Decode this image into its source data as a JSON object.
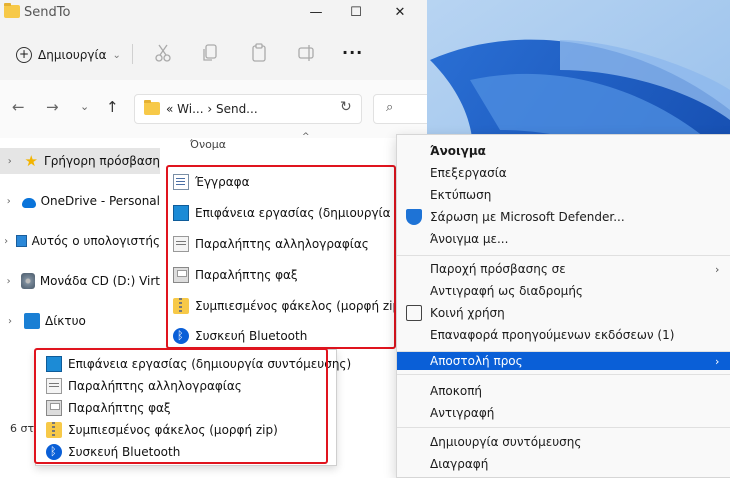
{
  "window": {
    "title": "SendTo",
    "minimize": "—",
    "maximize": "☐",
    "close": "✕"
  },
  "toolbar": {
    "new_label": "Δημιουργία",
    "new_caret": "⌄",
    "more": "···"
  },
  "address": {
    "path": "« Wi... › Send...",
    "chevron": "›",
    "refresh": "↻",
    "search_glyph": "⌕"
  },
  "nav": {
    "back": "←",
    "forward": "→",
    "dropdown": "⌄",
    "up": "↑"
  },
  "column_header": "Όνομα",
  "sort_caret": "^",
  "navpane": [
    {
      "label": "Γρήγορη πρόσβαση",
      "icon": "star-icon",
      "selected": true
    },
    {
      "label": "OneDrive - Personal",
      "icon": "cloud-icon",
      "selected": false
    },
    {
      "label": "Αυτός ο υπολογιστής",
      "icon": "computer-icon",
      "selected": false
    },
    {
      "label": "Μονάδα CD (D:) Virt",
      "icon": "cd-drive-icon",
      "selected": false
    },
    {
      "label": "Δίκτυο",
      "icon": "network-icon",
      "selected": false
    }
  ],
  "status": "6 στ",
  "files": [
    {
      "label": "Έγγραφα",
      "icon": "documents-icon"
    },
    {
      "label": "Επιφάνεια εργασίας (δημιουργία συντ",
      "icon": "desktop-icon"
    },
    {
      "label": "Παραλήπτης αλληλογραφίας",
      "icon": "mail-recipient-icon"
    },
    {
      "label": "Παραλήπτης φαξ",
      "icon": "fax-recipient-icon"
    },
    {
      "label": "Συμπιεσμένος φάκελος (μορφή zip)",
      "icon": "zip-folder-icon"
    },
    {
      "label": "Συσκευή Bluetooth",
      "icon": "bluetooth-icon"
    }
  ],
  "context_menu": [
    {
      "label": "Άνοιγμα",
      "bold": true
    },
    {
      "label": "Επεξεργασία"
    },
    {
      "label": "Εκτύπωση"
    },
    {
      "label": "Σάρωση με Microsoft Defender...",
      "icon": "defender-shield-icon"
    },
    {
      "label": "Άνοιγμα με..."
    },
    {
      "separator": true
    },
    {
      "label": "Παροχή πρόσβασης σε",
      "submenu": true
    },
    {
      "label": "Αντιγραφή ως διαδρομής"
    },
    {
      "label": "Κοινή χρήση",
      "icon": "share-icon"
    },
    {
      "label": "Επαναφορά προηγούμενων εκδόσεων (1)"
    },
    {
      "separator": true
    },
    {
      "label": "Αποστολή προς",
      "submenu": true,
      "highlighted": true
    },
    {
      "separator": true
    },
    {
      "label": "Αποκοπή"
    },
    {
      "label": "Αντιγραφή"
    },
    {
      "separator": true
    },
    {
      "label": "Δημιουργία συντόμευσης"
    },
    {
      "label": "Διαγραφή"
    }
  ],
  "sendto_submenu": [
    {
      "label": "Επιφάνεια εργασίας (δημιουργία συντόμευσης)",
      "icon": "desktop-icon"
    },
    {
      "label": "Παραλήπτης αλληλογραφίας",
      "icon": "mail-recipient-icon"
    },
    {
      "label": "Παραλήπτης φαξ",
      "icon": "fax-recipient-icon"
    },
    {
      "label": "Συμπιεσμένος φάκελος (μορφή zip)",
      "icon": "zip-folder-icon"
    },
    {
      "label": "Συσκευή Bluetooth",
      "icon": "bluetooth-icon"
    }
  ],
  "colors": {
    "highlight": "#0a5fd7",
    "annotation_red": "#e0141e",
    "folder_yellow": "#f7c948"
  }
}
